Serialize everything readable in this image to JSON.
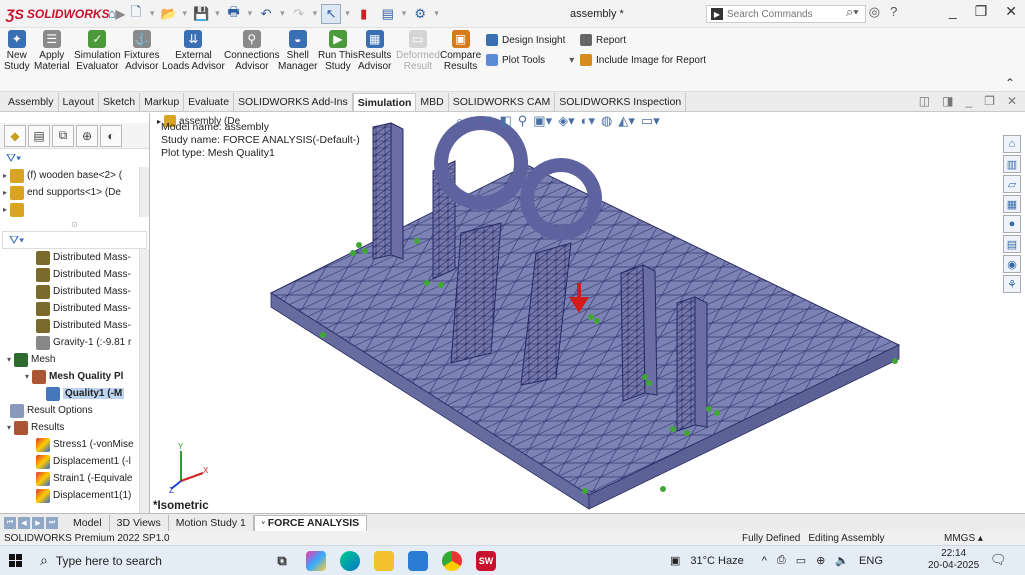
{
  "app": {
    "brand": "SOLIDWORKS",
    "document_title": "assembly *",
    "search_placeholder": "Search Commands"
  },
  "ribbon": {
    "buttons": [
      {
        "label": "New\nStudy"
      },
      {
        "label": "Apply\nMaterial"
      },
      {
        "label": "Simulation\nEvaluator"
      },
      {
        "label": "Fixtures\nAdvisor"
      },
      {
        "label": "External\nLoads Advisor"
      },
      {
        "label": "Connections\nAdvisor"
      },
      {
        "label": "Shell\nManager"
      },
      {
        "label": "Run This\nStudy"
      },
      {
        "label": "Results\nAdvisor"
      },
      {
        "label": "Deformed\nResult"
      },
      {
        "label": "Compare\nResults"
      }
    ],
    "design_insight": "Design Insight",
    "plot_tools": "Plot Tools",
    "report": "Report",
    "include_image": "Include Image for Report"
  },
  "cm_tabs": [
    "Assembly",
    "Layout",
    "Sketch",
    "Markup",
    "Evaluate",
    "SOLIDWORKS Add-Ins",
    "Simulation",
    "MBD",
    "SOLIDWORKS CAM",
    "SOLIDWORKS Inspection"
  ],
  "cm_active": "Simulation",
  "feature_tree_top": [
    {
      "label": "(f) wooden base<2> ("
    },
    {
      "label": "end supports<1> (De"
    }
  ],
  "study_tree": [
    {
      "label": "Distributed Mass-",
      "icon": "mass"
    },
    {
      "label": "Distributed Mass-",
      "icon": "mass"
    },
    {
      "label": "Distributed Mass-",
      "icon": "mass"
    },
    {
      "label": "Distributed Mass-",
      "icon": "mass"
    },
    {
      "label": "Distributed Mass-",
      "icon": "mass"
    },
    {
      "label": "Gravity-1 (:-9.81 r",
      "icon": "grav"
    },
    {
      "label": "Mesh",
      "icon": "mesh"
    },
    {
      "label": "Mesh Quality Pl",
      "icon": "res"
    },
    {
      "label": "Quality1 (-M",
      "icon": "qual"
    },
    {
      "label": "Result Options",
      "icon": "opt"
    },
    {
      "label": "Results",
      "icon": "res"
    },
    {
      "label": "Stress1 (-vonMise",
      "icon": "plot"
    },
    {
      "label": "Displacement1 (-l",
      "icon": "plot"
    },
    {
      "label": "Strain1 (-Equivale",
      "icon": "plot"
    },
    {
      "label": "Displacement1(1)",
      "icon": "plot"
    }
  ],
  "viewport": {
    "tree_label": "assembly (De",
    "model_name": "Model name: assembly",
    "study_name": "Study name: FORCE ANALYSIS(-Default-)",
    "plot_type": "Plot type: Mesh Quality1",
    "view_name": "*Isometric",
    "triad_labels": {
      "x": "X",
      "y": "Y",
      "z": "Z"
    }
  },
  "bottom_tabs": [
    "Model",
    "3D Views",
    "Motion Study 1",
    "FORCE ANALYSIS"
  ],
  "bottom_active": "FORCE ANALYSIS",
  "status": {
    "product": "SOLIDWORKS Premium 2022 SP1.0",
    "defined": "Fully Defined",
    "mode": "Editing Assembly",
    "units": "MMGS"
  },
  "taskbar": {
    "search": "Type here to search",
    "weather": "31°C  Haze",
    "lang": "ENG",
    "time": "22:14",
    "date": "20-04-2025"
  }
}
